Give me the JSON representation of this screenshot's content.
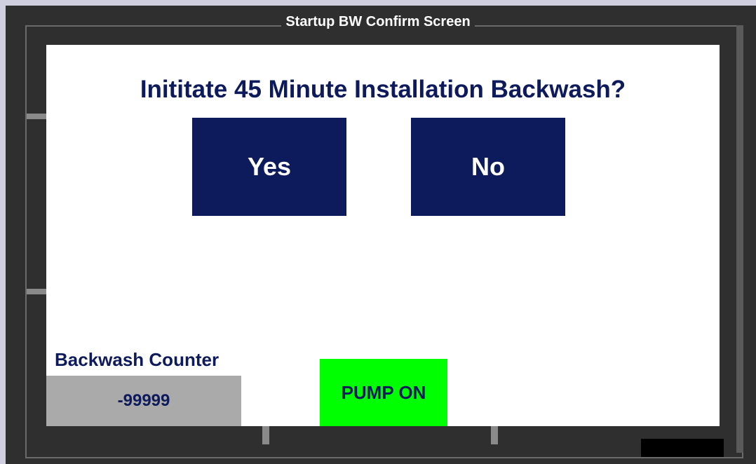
{
  "window": {
    "title": "Startup BW Confirm Screen"
  },
  "dialog": {
    "question": "Inititate 45 Minute Installation Backwash?",
    "yes_label": "Yes",
    "no_label": "No"
  },
  "counter": {
    "label": "Backwash Counter",
    "value": "-99999"
  },
  "status": {
    "pump_label": "PUMP ON",
    "pump_color": "#00ff00"
  },
  "colors": {
    "accent": "#0d1a5c",
    "frame": "#2f2f2f",
    "counter_bg": "#aaaaaa"
  }
}
